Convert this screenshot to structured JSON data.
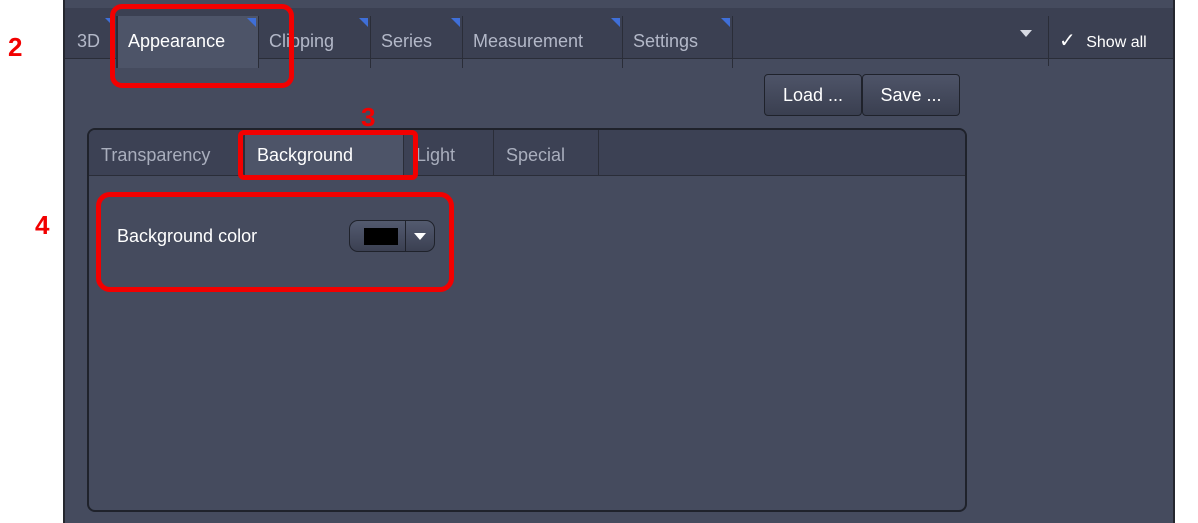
{
  "top_tabs": [
    {
      "label": "3D"
    },
    {
      "label": "Appearance"
    },
    {
      "label": "Clipping"
    },
    {
      "label": "Series"
    },
    {
      "label": "Measurement"
    },
    {
      "label": "Settings"
    }
  ],
  "toolbar": {
    "show_all_label": "Show all",
    "load_label": "Load ...",
    "save_label": "Save ..."
  },
  "inner_tabs": [
    {
      "label": "Transparency"
    },
    {
      "label": "Background"
    },
    {
      "label": "Light"
    },
    {
      "label": "Special"
    }
  ],
  "background": {
    "label": "Background color",
    "color_value": "#000000"
  },
  "annotations": {
    "n2": "2",
    "n3": "3",
    "n4": "4"
  },
  "colors": {
    "panel": "#454b5e",
    "tabbar": "#3b4052",
    "accent_corner": "#3f6fd8",
    "highlight": "#f20000"
  }
}
